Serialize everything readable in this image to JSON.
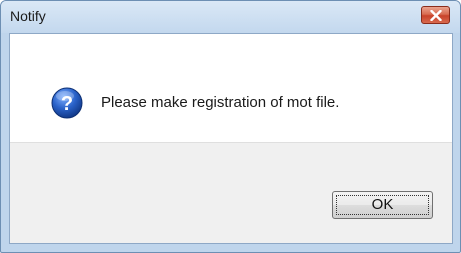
{
  "window": {
    "title": "Notify",
    "close_icon": "close-icon"
  },
  "message": {
    "icon": "question-icon",
    "text": "Please make registration of mot file."
  },
  "buttons": {
    "ok_label": "OK"
  },
  "colors": {
    "title_bar": "#c3d8ee",
    "close_button": "#c8422a",
    "icon_blue": "#1f4fa8",
    "footer": "#f0f0f0"
  }
}
